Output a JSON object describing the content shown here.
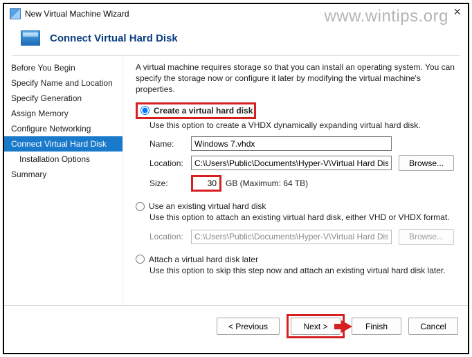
{
  "watermark": "www.wintips.org",
  "window": {
    "title": "New Virtual Machine Wizard"
  },
  "header": {
    "title": "Connect Virtual Hard Disk"
  },
  "sidebar": [
    "Before You Begin",
    "Specify Name and Location",
    "Specify Generation",
    "Assign Memory",
    "Configure Networking",
    "Connect Virtual Hard Disk",
    "Installation Options",
    "Summary"
  ],
  "intro": "A virtual machine requires storage so that you can install an operating system. You can specify the storage now or configure it later by modifying the virtual machine's properties.",
  "opt1": {
    "label": "Create a virtual hard disk",
    "desc": "Use this option to create a VHDX dynamically expanding virtual hard disk.",
    "name_label": "Name:",
    "name_value": "Windows 7.vhdx",
    "loc_label": "Location:",
    "loc_value": "C:\\Users\\Public\\Documents\\Hyper-V\\Virtual Hard Disks\\",
    "browse": "Browse...",
    "size_label": "Size:",
    "size_value": "30",
    "size_suffix": "GB (Maximum: 64 TB)"
  },
  "opt2": {
    "label": "Use an existing virtual hard disk",
    "desc": "Use this option to attach an existing virtual hard disk, either VHD or VHDX format.",
    "loc_label": "Location:",
    "loc_value": "C:\\Users\\Public\\Documents\\Hyper-V\\Virtual Hard Disks\\",
    "browse": "Browse..."
  },
  "opt3": {
    "label": "Attach a virtual hard disk later",
    "desc": "Use this option to skip this step now and attach an existing virtual hard disk later."
  },
  "footer": {
    "previous": "< Previous",
    "next": "Next >",
    "finish": "Finish",
    "cancel": "Cancel"
  }
}
